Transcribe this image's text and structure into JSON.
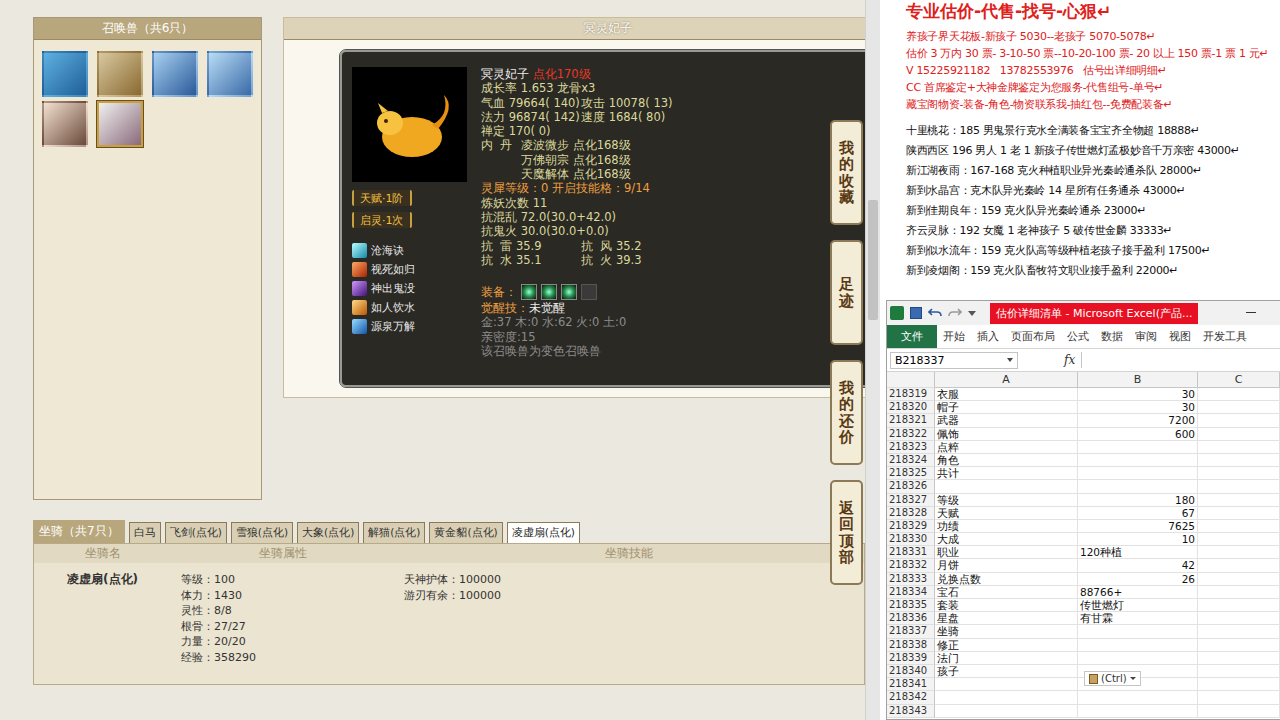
{
  "pets_panel": {
    "title": "召唤兽（共6只）",
    "pets": [
      {
        "selected": false
      },
      {
        "selected": false
      },
      {
        "selected": false
      },
      {
        "selected": false
      },
      {
        "selected": false
      },
      {
        "selected": true
      }
    ]
  },
  "pet_detail": {
    "title": "冥灵妃子",
    "name": "冥灵妃子",
    "level": "点化170级",
    "growth": "成长率 1.653 龙骨x3",
    "stat_rows": [
      [
        "气血 79664( 140)",
        "攻击 10078( 13)"
      ],
      [
        "法力 96874( 142)",
        "速度 1684( 80)"
      ],
      [
        "禅定 170( 0)"
      ]
    ],
    "neidan_label": "内  丹",
    "neidan": [
      "凌波微步 点化168级",
      "万佛朝宗 点化168级",
      "天魔解体 点化168级"
    ],
    "info": [
      "灵犀等级：0 开启技能格：9/14",
      "炼妖次数 11",
      "抗混乱 72.0(30.0+42.0)",
      "抗鬼火 30.0(30.0+0.0)"
    ],
    "resist_rows": [
      [
        "抗  雷 35.9",
        "抗  风 35.2"
      ],
      [
        "抗  水 35.1",
        "抗  火 39.3"
      ]
    ],
    "equip_label": "装备：",
    "equipment": [
      {
        "filled": true
      },
      {
        "filled": true
      },
      {
        "filled": true
      },
      {
        "filled": false
      }
    ],
    "awaken_label": "觉醒技：",
    "awaken_value": "未觉醒",
    "footer": [
      "金:37 木:0 水:62 火:0 土:0",
      "亲密度:15",
      "该召唤兽为变色召唤兽"
    ],
    "badges": [
      "天赋·1阶",
      "启灵·1次"
    ],
    "skills": [
      "沧海诀",
      "视死如归",
      "神出鬼没",
      "如人饮水",
      "源泉万解"
    ]
  },
  "side_buttons": [
    "我的收藏",
    "足迹",
    "我的还价",
    "返回顶部"
  ],
  "mounts": {
    "label": "坐骑（共7只）",
    "tabs": [
      {
        "label": "白马",
        "selected": false
      },
      {
        "label": "飞剑(点化)",
        "selected": false
      },
      {
        "label": "雪狼(点化)",
        "selected": false
      },
      {
        "label": "大象(点化)",
        "selected": false
      },
      {
        "label": "解猫(点化)",
        "selected": false
      },
      {
        "label": "黄金貂(点化)",
        "selected": false
      },
      {
        "label": "凌虚扇(点化)",
        "selected": true
      }
    ],
    "columns": [
      "坐骑名",
      "坐骑属性",
      "坐骑技能"
    ],
    "row": {
      "name": "凌虚扇(点化)",
      "attributes": [
        "等级：100",
        "体力：1430",
        "灵性：8/8",
        "根骨：27/27",
        "力量：20/20",
        "经验：358290"
      ],
      "skills": [
        "天神护体：100000",
        "游刃有余：100000"
      ]
    }
  },
  "ads": {
    "headline": "专业估价-代售-找号-心狠↵",
    "red_lines": [
      "养孩子界天花板-新孩子 5030--老孩子 5070-5078↵",
      "估价 3 万内 30 票- 3-10-50 票--10-20-100 票- 20 以上 150 票-1 票 1 元↵",
      "V 15225921182   13782553976   估号出详细明细↵",
      "CC 首席鉴定+大神金牌鉴定为您服务-代售组号-单号↵",
      "藏宝阁物资-装备-角色-物资联系我-抽红包--免费配装备↵"
    ],
    "listings": [
      "十里桃花：185 男鬼景行克水全满装备宝宝齐全物超 18888↵",
      "陕西西区 196 男人 1 老 1 新孩子传世燃灯孟极妙音千万亲密 43000↵",
      "新江湖夜雨：167-168 克火种植职业异光秦岭通杀队 28000↵",
      "新到水晶宫：克木队异光秦岭 14 星所有任务通杀 43000↵",
      "新到佳期良年：159 克火队异光秦岭通杀 23000↵",
      "齐云灵脉：192 女魔 1 老神孩子 5 破传世金麟 33333↵",
      "新到似水流年：159 克火队高等级种植老孩子接手盈利 17500↵",
      "新到凌烟阁：159 克火队畜牧符文职业接手盈利 22000↵"
    ]
  },
  "excel": {
    "title": "估价详细清单 - Microsoft Excel(产品...",
    "ribbon_tabs": [
      {
        "label": "文件",
        "selected": true
      },
      {
        "label": "开始",
        "selected": false
      },
      {
        "label": "插入",
        "selected": false
      },
      {
        "label": "页面布局",
        "selected": false
      },
      {
        "label": "公式",
        "selected": false
      },
      {
        "label": "数据",
        "selected": false
      },
      {
        "label": "审阅",
        "selected": false
      },
      {
        "label": "视图",
        "selected": false
      },
      {
        "label": "开发工具",
        "selected": false
      }
    ],
    "name_box": "B218337",
    "fx": "fx",
    "columns": [
      "A",
      "B",
      "C"
    ],
    "rows": [
      {
        "num": "218319",
        "a": "衣服",
        "b": "30",
        "kind": "number"
      },
      {
        "num": "218320",
        "a": "帽子",
        "b": "30",
        "kind": "number"
      },
      {
        "num": "218321",
        "a": "武器",
        "b": "7200",
        "kind": "number"
      },
      {
        "num": "218322",
        "a": "佩饰",
        "b": "600",
        "kind": "number"
      },
      {
        "num": "218323",
        "a": "点粹",
        "b": "",
        "kind": "text"
      },
      {
        "num": "218324",
        "a": "角色",
        "b": "",
        "kind": "text"
      },
      {
        "num": "218325",
        "a": "共计",
        "b": "",
        "kind": "text"
      },
      {
        "num": "218326",
        "a": "",
        "b": "",
        "kind": "text"
      },
      {
        "num": "218327",
        "a": "等级",
        "b": "180",
        "kind": "number"
      },
      {
        "num": "218328",
        "a": "天赋",
        "b": "67",
        "kind": "number"
      },
      {
        "num": "218329",
        "a": "功绩",
        "b": "7625",
        "kind": "number"
      },
      {
        "num": "218330",
        "a": "大成",
        "b": "10",
        "kind": "number"
      },
      {
        "num": "218331",
        "a": "职业",
        "b": "120种植",
        "kind": "text"
      },
      {
        "num": "218332",
        "a": "月饼",
        "b": "42",
        "kind": "number"
      },
      {
        "num": "218333",
        "a": "兑换点数",
        "b": "26",
        "kind": "number"
      },
      {
        "num": "218334",
        "a": "宝石",
        "b": "88766+",
        "kind": "text"
      },
      {
        "num": "218335",
        "a": "套装",
        "b": "传世燃灯",
        "kind": "text"
      },
      {
        "num": "218336",
        "a": "星盘",
        "b": "有甘霖",
        "kind": "text"
      },
      {
        "num": "218337",
        "a": "坐骑",
        "b": "",
        "kind": "text"
      },
      {
        "num": "218338",
        "a": "修正",
        "b": "",
        "kind": "text"
      },
      {
        "num": "218339",
        "a": "法门",
        "b": "",
        "kind": "text"
      },
      {
        "num": "218340",
        "a": "孩子",
        "b": "",
        "kind": "text"
      },
      {
        "num": "218341",
        "a": "",
        "b": "",
        "kind": "text"
      },
      {
        "num": "218342",
        "a": "",
        "b": "",
        "kind": "text"
      },
      {
        "num": "218343",
        "a": "",
        "b": "",
        "kind": "text"
      }
    ],
    "paste_hint": "(Ctrl)"
  }
}
